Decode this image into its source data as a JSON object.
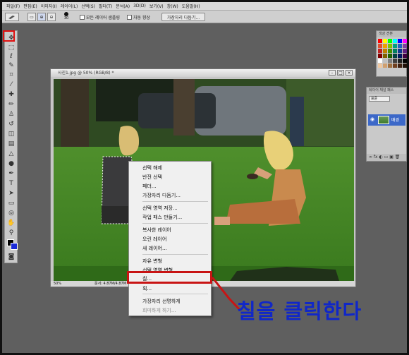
{
  "menubar": {
    "items": [
      "파일(F)",
      "편집(E)",
      "이미지(I)",
      "레이어(L)",
      "선택(S)",
      "필터(T)",
      "분석(A)",
      "3D(D)",
      "보기(V)",
      "창(W)",
      "도움말(H)"
    ]
  },
  "options": {
    "brush_size": "30",
    "sample_all_layers": "모든 레이어 샘플링",
    "auto_enhance": "자동 향상",
    "refine_edge_button": "가장자리 다듬기..."
  },
  "document": {
    "title": "사진1.jpg @ 50% (RGB/8) *",
    "zoom": "50%",
    "status": "문서: 4.87M/4.87M"
  },
  "context_menu": {
    "items": [
      {
        "label": "선택 해제",
        "enabled": true
      },
      {
        "label": "반전 선택",
        "enabled": true
      },
      {
        "label": "페더...",
        "enabled": true
      },
      {
        "label": "가장자리 다듬기...",
        "enabled": true
      },
      {
        "label": "선택 영역 저장...",
        "enabled": true
      },
      {
        "label": "작업 패스 만들기...",
        "enabled": true
      },
      {
        "label": "복사한 레이어",
        "enabled": true
      },
      {
        "label": "오린 레이어",
        "enabled": true
      },
      {
        "label": "새 레이어...",
        "enabled": true
      },
      {
        "label": "자유 변형",
        "enabled": true
      },
      {
        "label": "선택 영역 변형",
        "enabled": true
      },
      {
        "label": "칠...",
        "enabled": true
      },
      {
        "label": "획...",
        "enabled": true
      },
      {
        "label": "가장자리 선명하게",
        "enabled": true
      },
      {
        "label": "희미하게 하기...",
        "enabled": false
      }
    ]
  },
  "swatches_panel": {
    "tabs": "색상 견본"
  },
  "layers_panel": {
    "tabs": "레이어 채널 패스",
    "blend_mode": "표준",
    "layer_name": "배경",
    "bottom_icons": "∞ fx ◐ ▭ ▣ 🗑"
  },
  "annotation": {
    "text": "칠을 클릭한다",
    "color": "#1027c8",
    "highlight_color": "#c81414"
  }
}
